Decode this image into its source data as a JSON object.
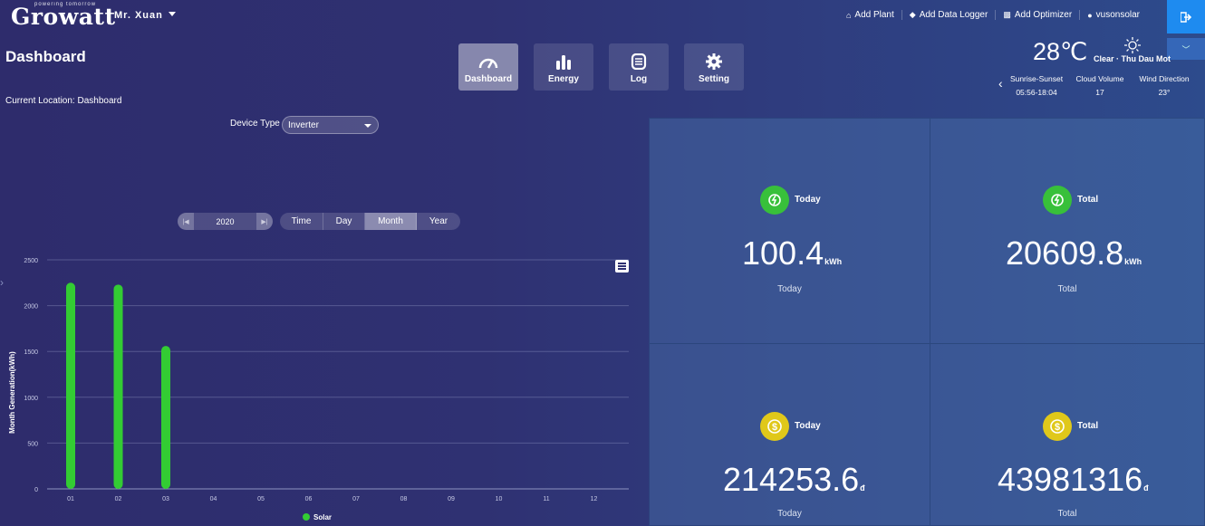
{
  "header": {
    "logo": "Growatt",
    "logo_tagline": "powering tomorrow",
    "user_menu": "Mr. Xuan",
    "links": [
      {
        "icon": "home-icon",
        "label": "Add Plant"
      },
      {
        "icon": "datalogger-icon",
        "label": "Add Data Logger"
      },
      {
        "icon": "optimizer-icon",
        "label": "Add Optimizer"
      },
      {
        "icon": "user-icon",
        "label": "vusonsolar"
      }
    ]
  },
  "page": {
    "title": "Dashboard",
    "location": "Current Location: Dashboard"
  },
  "tabs": [
    {
      "label": "Dashboard",
      "icon": "gauge-icon",
      "active": true
    },
    {
      "label": "Energy",
      "icon": "bar-chart-icon",
      "active": false
    },
    {
      "label": "Log",
      "icon": "log-icon",
      "active": false
    },
    {
      "label": "Setting",
      "icon": "gear-icon",
      "active": false
    }
  ],
  "weather": {
    "temperature": "28℃",
    "condition": "Clear · Thu Dau Mot",
    "icon": "sun-icon",
    "details": [
      {
        "label": "Sunrise-Sunset",
        "value": "05:56-18:04"
      },
      {
        "label": "Cloud Volume",
        "value": "17"
      },
      {
        "label": "Wind Direction",
        "value": "23°"
      }
    ]
  },
  "device": {
    "label": "Device Type",
    "selected": "Inverter"
  },
  "period": {
    "year": "2020",
    "options": [
      "Time",
      "Day",
      "Month",
      "Year"
    ],
    "active": "Month"
  },
  "chart_data": {
    "type": "bar",
    "categories": [
      "01",
      "02",
      "03",
      "04",
      "05",
      "06",
      "07",
      "08",
      "09",
      "10",
      "11",
      "12"
    ],
    "series": [
      {
        "name": "Solar",
        "values": [
          2250,
          2230,
          1560,
          0,
          0,
          0,
          0,
          0,
          0,
          0,
          0,
          0
        ],
        "color": "#33cc33"
      }
    ],
    "ylabel": "Month Generation(kWh)",
    "ylim": [
      0,
      2500
    ],
    "yticks": [
      "0",
      "500",
      "1000",
      "1500",
      "2000",
      "2500"
    ],
    "grid": true,
    "legend": "bottom"
  },
  "cards": [
    {
      "label": "Today",
      "value": "100.4",
      "unit": "kWh",
      "sub": "Today",
      "icon": "energy-icon",
      "color": "#38c03a"
    },
    {
      "label": "Total",
      "value": "20609.8",
      "unit": "kWh",
      "sub": "Total",
      "icon": "energy-icon",
      "color": "#38c03a"
    },
    {
      "label": "Today",
      "value": "214253.6",
      "unit": "đ",
      "sub": "Today",
      "icon": "coin-icon",
      "color": "#e0c81a"
    },
    {
      "label": "Total",
      "value": "43981316",
      "unit": "đ",
      "sub": "Total",
      "icon": "coin-icon",
      "color": "#e0c81a"
    }
  ]
}
